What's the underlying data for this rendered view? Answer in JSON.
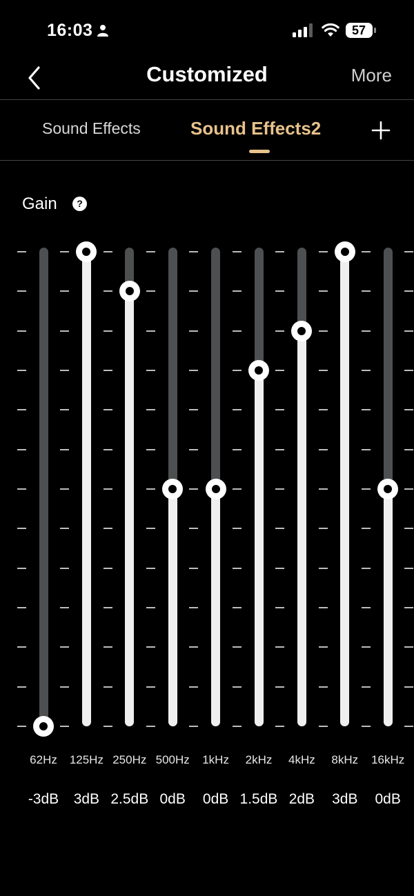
{
  "status": {
    "time": "16:03",
    "battery": "57"
  },
  "nav": {
    "title": "Customized",
    "more": "More"
  },
  "tabs": [
    {
      "label": "Sound Effects",
      "active": false
    },
    {
      "label": "Sound Effects2",
      "active": true
    }
  ],
  "gain": {
    "label": "Gain",
    "help": "?"
  },
  "colors": {
    "accent": "#e8c28c",
    "fill": "#efefef",
    "track": "#4d4f50"
  },
  "eq": {
    "range_db": [
      -3,
      3
    ],
    "bands": [
      {
        "freq": "62Hz",
        "gain": "-3dB",
        "value": -3
      },
      {
        "freq": "125Hz",
        "gain": "3dB",
        "value": 3
      },
      {
        "freq": "250Hz",
        "gain": "2.5dB",
        "value": 2.5
      },
      {
        "freq": "500Hz",
        "gain": "0dB",
        "value": 0
      },
      {
        "freq": "1kHz",
        "gain": "0dB",
        "value": 0
      },
      {
        "freq": "2kHz",
        "gain": "1.5dB",
        "value": 1.5
      },
      {
        "freq": "4kHz",
        "gain": "2dB",
        "value": 2
      },
      {
        "freq": "8kHz",
        "gain": "3dB",
        "value": 3
      },
      {
        "freq": "16kHz",
        "gain": "0dB",
        "value": 0
      }
    ]
  }
}
